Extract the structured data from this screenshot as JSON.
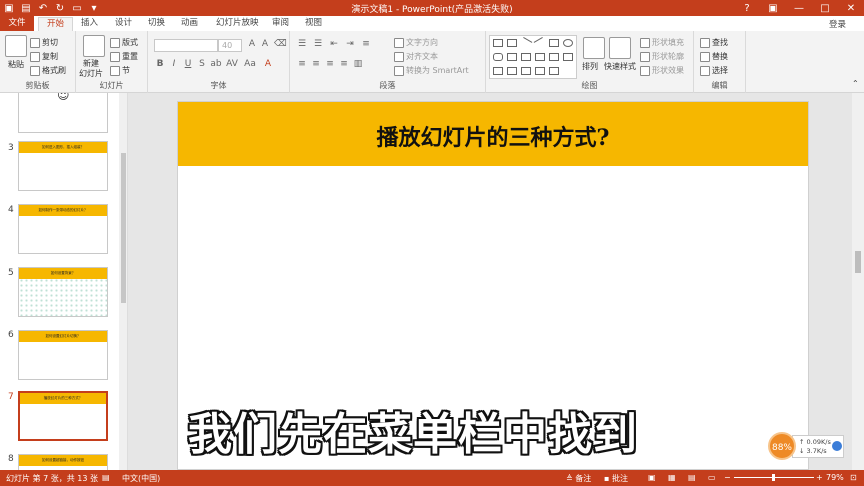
{
  "titlebar": {
    "title": "演示文稿1 - PowerPoint(产品激活失败)"
  },
  "tabs": {
    "file": "文件",
    "items": [
      "开始",
      "插入",
      "设计",
      "切换",
      "动画",
      "幻灯片放映",
      "审阅",
      "视图"
    ],
    "active": "开始",
    "login": "登录"
  },
  "ribbon": {
    "clipboard": {
      "paste": "粘贴",
      "cut": "剪切",
      "copy": "复制",
      "format_painter": "格式刷",
      "label": "剪贴板"
    },
    "slides": {
      "new_slide": "新建",
      "new_slide2": "幻灯片",
      "layout": "版式",
      "reset": "重置",
      "section": "节",
      "label": "幻灯片"
    },
    "font": {
      "size": "40",
      "label": "字体"
    },
    "paragraph": {
      "text_direction": "文字方向",
      "align_text": "对齐文本",
      "smartart": "转换为 SmartArt",
      "label": "段落"
    },
    "drawing": {
      "arrange": "排列",
      "quick_styles": "快速样式",
      "shape_fill": "形状填充",
      "shape_outline": "形状轮廓",
      "shape_effects": "形状效果",
      "label": "绘图"
    },
    "editing": {
      "find": "查找",
      "replace": "替换",
      "select": "选择",
      "label": "编辑"
    }
  },
  "thumbnails": [
    {
      "num": "3",
      "title": "如何进入图形，插入组装？"
    },
    {
      "num": "4",
      "title": "如何制作一张带动态的幻灯片？"
    },
    {
      "num": "5",
      "title": "如何设置背景？"
    },
    {
      "num": "6",
      "title": "如何设置幻灯片切换？"
    },
    {
      "num": "7",
      "title": "播放幻灯片的三种方式？"
    },
    {
      "num": "8",
      "title": "如何设置超链接，动作按钮"
    }
  ],
  "slide": {
    "title": "播放幻灯片的三种方式?"
  },
  "subtitle": "我们先在菜单栏中找到",
  "network": {
    "percent": "88%",
    "up": "0.09K/s",
    "down": "3.7K/s"
  },
  "status": {
    "slide_info": "幻灯片 第 7 张，共 13 张",
    "language": "中文(中国)",
    "notes": "备注",
    "comments": "批注",
    "zoom": "79%"
  },
  "colors": {
    "accent": "#c43e1c",
    "slide_header": "#f6b700"
  }
}
